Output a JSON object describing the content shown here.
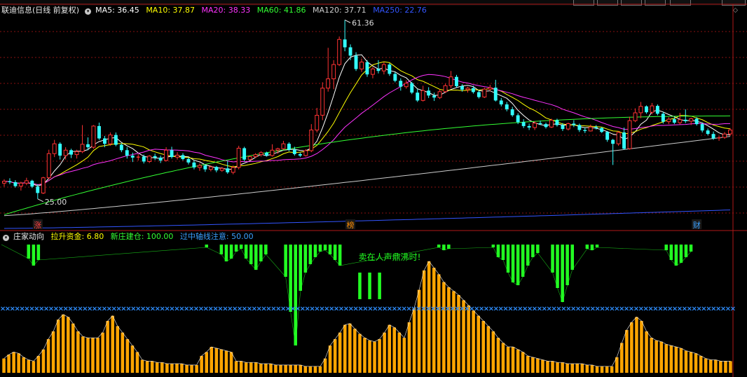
{
  "window": {
    "title": "联迪信息"
  },
  "main_chart": {
    "legend": {
      "title": "联迪信息(日线 前复权)",
      "ma": [
        {
          "label": "MA5: 36.45",
          "color": "#ffffff"
        },
        {
          "label": "MA10: 37.87",
          "color": "#ffff00"
        },
        {
          "label": "MA20: 38.33",
          "color": "#ff33ff"
        },
        {
          "label": "MA60: 41.86",
          "color": "#33ff33"
        },
        {
          "label": "MA120: 37.71",
          "color": "#cccccc"
        },
        {
          "label": "MA250: 22.76",
          "color": "#3355ff"
        }
      ]
    },
    "high_label": "61.36",
    "low_label": "25.00",
    "markers": [
      {
        "text": "涨",
        "color": "#ff4040"
      },
      {
        "text": "榜",
        "color": "#ff8c00"
      },
      {
        "text": "财",
        "color": "#3aa0ff"
      }
    ],
    "colors": {
      "up": "#ff3333",
      "down": "#33ffff",
      "bg": "#000000"
    }
  },
  "indicator": {
    "legend": {
      "name": "庄家动向",
      "items": [
        {
          "label": "拉升资金: 6.80",
          "color": "#ffff00"
        },
        {
          "label": "新庄建仓: 100.00",
          "color": "#33ff33"
        },
        {
          "label": "过中轴线注意: 50.00",
          "color": "#33a0ff"
        }
      ]
    },
    "annotation": "卖在人声鼎沸时!",
    "colors": {
      "bars": "#ffa500",
      "green": "#22ff22",
      "axis": "#2f8fff"
    }
  },
  "chart_data": [
    {
      "type": "candlestick",
      "title": "联迪信息(日线 前复权)",
      "y_range": [
        19,
        62
      ],
      "high": 61.36,
      "low": 25.0,
      "candles": [
        [
          28.2,
          29.0,
          27.5,
          28.6
        ],
        [
          28.6,
          29.2,
          28.0,
          28.4
        ],
        [
          28.4,
          28.8,
          27.3,
          27.6
        ],
        [
          27.6,
          28.5,
          26.7,
          28.2
        ],
        [
          28.2,
          29.3,
          27.8,
          28.7
        ],
        [
          28.7,
          28.9,
          27.2,
          27.5
        ],
        [
          27.5,
          28.0,
          25.0,
          26.2
        ],
        [
          26.2,
          29.5,
          26.0,
          29.3
        ],
        [
          29.3,
          35.0,
          29.0,
          34.2
        ],
        [
          34.2,
          37.0,
          33.5,
          36.2
        ],
        [
          36.2,
          36.5,
          33.0,
          33.8
        ],
        [
          33.8,
          35.5,
          33.0,
          34.9
        ],
        [
          34.9,
          35.2,
          33.3,
          34.0
        ],
        [
          34.0,
          35.0,
          33.2,
          34.6
        ],
        [
          34.6,
          40.0,
          34.3,
          36.1
        ],
        [
          36.1,
          37.5,
          34.9,
          35.5
        ],
        [
          35.5,
          40.0,
          35.2,
          39.8
        ],
        [
          39.8,
          40.5,
          37.0,
          37.3
        ],
        [
          37.3,
          37.8,
          35.5,
          36.2
        ],
        [
          36.2,
          38.5,
          35.8,
          38.0
        ],
        [
          38.0,
          38.5,
          35.7,
          36.0
        ],
        [
          36.0,
          36.3,
          34.5,
          34.9
        ],
        [
          34.9,
          35.5,
          33.2,
          33.8
        ],
        [
          33.8,
          34.4,
          32.5,
          33.4
        ],
        [
          33.4,
          34.1,
          32.8,
          33.6
        ],
        [
          33.6,
          34.0,
          32.2,
          32.6
        ],
        [
          32.6,
          33.9,
          32.3,
          33.7
        ],
        [
          33.7,
          34.2,
          32.9,
          33.4
        ],
        [
          33.4,
          33.8,
          32.3,
          32.8
        ],
        [
          32.8,
          35.5,
          32.6,
          34.9
        ],
        [
          34.9,
          35.6,
          33.2,
          33.5
        ],
        [
          33.5,
          34.5,
          33.0,
          33.9
        ],
        [
          33.9,
          34.3,
          32.8,
          33.1
        ],
        [
          33.1,
          33.4,
          32.0,
          32.4
        ],
        [
          32.4,
          32.9,
          31.0,
          31.4
        ],
        [
          31.4,
          32.2,
          30.7,
          31.8
        ],
        [
          31.8,
          32.0,
          30.5,
          31.0
        ],
        [
          31.0,
          31.8,
          30.6,
          31.5
        ],
        [
          31.5,
          31.7,
          30.4,
          30.8
        ],
        [
          30.8,
          31.5,
          30.5,
          31.2
        ],
        [
          31.2,
          32.7,
          30.1,
          30.4
        ],
        [
          30.4,
          31.8,
          30.0,
          31.4
        ],
        [
          31.4,
          35.8,
          31.0,
          35.3
        ],
        [
          35.3,
          35.6,
          32.6,
          33.0
        ],
        [
          33.0,
          33.8,
          32.8,
          33.6
        ],
        [
          33.6,
          34.3,
          33.3,
          34.0
        ],
        [
          34.0,
          34.7,
          33.6,
          34.4
        ],
        [
          34.4,
          34.6,
          33.6,
          33.8
        ],
        [
          33.8,
          36.1,
          33.6,
          34.9
        ],
        [
          34.9,
          35.4,
          34.2,
          35.2
        ],
        [
          35.2,
          36.8,
          35.0,
          36.2
        ],
        [
          36.2,
          36.5,
          34.7,
          35.0
        ],
        [
          35.0,
          35.6,
          33.8,
          34.1
        ],
        [
          34.1,
          34.4,
          33.5,
          33.8
        ],
        [
          33.8,
          35.1,
          33.6,
          34.8
        ],
        [
          34.8,
          40.2,
          34.5,
          39.0
        ],
        [
          39.0,
          43.5,
          38.5,
          42.0
        ],
        [
          42.0,
          48.7,
          41.0,
          47.5
        ],
        [
          47.5,
          55.7,
          46.8,
          49.4
        ],
        [
          49.4,
          53.2,
          47.3,
          52.3
        ],
        [
          52.3,
          58.0,
          52.0,
          57.4
        ],
        [
          57.4,
          61.36,
          55.0,
          55.8
        ],
        [
          55.8,
          56.4,
          53.2,
          54.1
        ],
        [
          54.1,
          54.8,
          51.0,
          51.4
        ],
        [
          51.4,
          53.5,
          50.8,
          52.8
        ],
        [
          52.8,
          53.2,
          49.8,
          50.3
        ],
        [
          50.3,
          51.8,
          49.5,
          51.4
        ],
        [
          51.4,
          53.2,
          50.5,
          51.0
        ],
        [
          51.0,
          52.8,
          50.3,
          52.3
        ],
        [
          52.3,
          52.6,
          50.0,
          50.4
        ],
        [
          50.4,
          50.8,
          48.7,
          49.0
        ],
        [
          49.0,
          49.5,
          47.0,
          47.8
        ],
        [
          47.8,
          49.1,
          47.4,
          48.5
        ],
        [
          48.5,
          48.8,
          46.3,
          46.6
        ],
        [
          46.6,
          47.3,
          44.7,
          45.0
        ],
        [
          45.0,
          48.0,
          44.8,
          47.0
        ],
        [
          47.0,
          47.7,
          45.5,
          46.0
        ],
        [
          46.0,
          46.6,
          44.9,
          45.6
        ],
        [
          45.6,
          47.3,
          45.3,
          46.8
        ],
        [
          46.8,
          48.4,
          46.5,
          48.0
        ],
        [
          48.0,
          51.0,
          47.5,
          49.8
        ],
        [
          49.8,
          50.2,
          47.6,
          47.9
        ],
        [
          47.9,
          48.3,
          46.8,
          47.2
        ],
        [
          47.2,
          47.8,
          46.6,
          47.5
        ],
        [
          47.5,
          48.0,
          46.4,
          46.7
        ],
        [
          46.7,
          47.1,
          45.4,
          45.7
        ],
        [
          45.7,
          47.6,
          45.5,
          47.3
        ],
        [
          47.3,
          48.2,
          46.9,
          47.6
        ],
        [
          47.6,
          49.2,
          44.8,
          45.0
        ],
        [
          45.0,
          45.5,
          43.8,
          44.2
        ],
        [
          44.2,
          44.7,
          42.8,
          43.2
        ],
        [
          43.2,
          43.7,
          41.7,
          42.0
        ],
        [
          42.0,
          42.4,
          40.2,
          40.6
        ],
        [
          40.6,
          41.2,
          39.4,
          39.8
        ],
        [
          39.8,
          40.3,
          39.0,
          39.5
        ],
        [
          39.5,
          40.8,
          39.0,
          40.4
        ],
        [
          40.4,
          40.9,
          40.0,
          40.2
        ],
        [
          40.2,
          40.5,
          39.3,
          39.6
        ],
        [
          39.6,
          41.3,
          39.4,
          41.0
        ],
        [
          41.0,
          41.3,
          39.7,
          40.0
        ],
        [
          40.0,
          40.4,
          38.8,
          39.2
        ],
        [
          39.2,
          40.5,
          38.9,
          40.3
        ],
        [
          40.3,
          41.0,
          39.6,
          40.0
        ],
        [
          40.0,
          40.3,
          38.6,
          39.0
        ],
        [
          39.0,
          39.5,
          38.4,
          38.8
        ],
        [
          38.8,
          40.1,
          38.7,
          39.6
        ],
        [
          39.6,
          40.0,
          39.1,
          39.4
        ],
        [
          39.4,
          39.6,
          38.4,
          38.6
        ],
        [
          38.6,
          38.8,
          36.6,
          37.0
        ],
        [
          37.0,
          37.2,
          31.9,
          36.2
        ],
        [
          36.2,
          38.8,
          35.8,
          38.5
        ],
        [
          38.5,
          39.5,
          35.0,
          35.2
        ],
        [
          35.2,
          41.7,
          35.0,
          40.9
        ],
        [
          40.9,
          43.4,
          40.6,
          42.5
        ],
        [
          42.5,
          44.7,
          41.4,
          43.8
        ],
        [
          43.8,
          44.0,
          42.3,
          42.6
        ],
        [
          42.6,
          44.5,
          42.2,
          43.9
        ],
        [
          43.9,
          44.2,
          42.0,
          42.3
        ],
        [
          42.3,
          42.7,
          40.3,
          40.7
        ],
        [
          40.7,
          41.6,
          40.2,
          41.2
        ],
        [
          41.2,
          41.6,
          40.2,
          40.5
        ],
        [
          40.5,
          42.5,
          40.1,
          41.1
        ],
        [
          41.1,
          43.2,
          40.4,
          40.8
        ],
        [
          40.8,
          41.5,
          40.0,
          41.3
        ],
        [
          41.3,
          41.6,
          39.9,
          40.2
        ],
        [
          40.2,
          40.5,
          38.5,
          38.9
        ],
        [
          38.9,
          39.3,
          37.9,
          38.2
        ],
        [
          38.2,
          38.7,
          37.0,
          37.3
        ],
        [
          37.3,
          37.8,
          36.8,
          37.5
        ],
        [
          37.5,
          38.6,
          37.2,
          38.2
        ],
        [
          38.2,
          39.4,
          37.8,
          39.0
        ]
      ],
      "ma_lines": [
        {
          "name": "MA5",
          "value": 36.45,
          "color": "#ffffff"
        },
        {
          "name": "MA10",
          "value": 37.87,
          "color": "#ffff00"
        },
        {
          "name": "MA20",
          "value": 38.33,
          "color": "#ff33ff"
        },
        {
          "name": "MA60",
          "value": 41.86,
          "color": "#33ff33"
        },
        {
          "name": "MA120",
          "value": 37.71,
          "color": "#cccccc"
        },
        {
          "name": "MA250",
          "value": 22.76,
          "color": "#3355ff"
        }
      ]
    },
    {
      "type": "bar",
      "title": "庄家动向",
      "y_range": [
        0,
        100
      ],
      "midline": 50,
      "orange_values": [
        11,
        14,
        16,
        15,
        12,
        10,
        9,
        13,
        18,
        26,
        32,
        41,
        45,
        43,
        38,
        32,
        28,
        27,
        27,
        27,
        31,
        40,
        44,
        36,
        31,
        26,
        21,
        16,
        10,
        9,
        9,
        8,
        8,
        7,
        7,
        7,
        7,
        6,
        6,
        6,
        13,
        16,
        20,
        19,
        18,
        17,
        16,
        9,
        9,
        8,
        8,
        8,
        7,
        7,
        7,
        6,
        6,
        6,
        6,
        6,
        6,
        5,
        5,
        5,
        5,
        11,
        21,
        26,
        31,
        37,
        38,
        34,
        30,
        27,
        25,
        24,
        26,
        31,
        37,
        35,
        31,
        27,
        39,
        50,
        64,
        79,
        86,
        81,
        76,
        70,
        66,
        63,
        60,
        56,
        52,
        48,
        44,
        40,
        36,
        32,
        27,
        23,
        20,
        20,
        18,
        16,
        13,
        12,
        11,
        10,
        9,
        9,
        8,
        8,
        7,
        7,
        7,
        7,
        6,
        6,
        5,
        5,
        5,
        5,
        12,
        23,
        33,
        39,
        43,
        40,
        32,
        27,
        25,
        24,
        22,
        21,
        20,
        19,
        17,
        16,
        15,
        13,
        11,
        10,
        10,
        9,
        9,
        9
      ],
      "green_values": [
        0,
        0,
        0,
        0,
        0,
        0,
        0,
        0,
        0,
        0,
        0,
        0,
        0,
        0,
        0,
        0,
        0,
        0,
        0,
        0,
        0,
        0,
        0,
        0,
        0,
        0,
        0,
        0,
        0,
        0,
        0,
        0,
        0,
        0,
        0,
        0,
        0,
        0,
        0,
        0,
        0,
        0,
        12,
        20,
        18,
        8,
        0,
        0,
        0,
        0,
        0,
        0,
        0,
        0,
        0,
        0,
        0,
        0,
        0,
        0,
        0,
        0,
        0,
        0,
        0,
        0,
        0,
        0,
        0,
        0,
        0,
        0,
        0,
        0,
        0,
        0,
        0,
        0,
        0,
        0,
        0,
        0,
        0,
        0,
        0,
        0,
        0,
        0,
        0,
        0,
        0,
        0,
        0,
        0,
        0,
        0,
        0,
        0,
        0,
        0,
        0,
        0,
        0,
        0,
        0,
        0,
        0,
        0,
        0,
        0,
        0,
        0,
        0,
        0,
        0,
        0,
        0,
        0,
        0,
        0,
        0,
        0,
        0,
        0,
        0,
        0,
        0,
        0,
        0,
        0,
        0,
        0,
        0,
        0,
        0,
        0,
        0,
        0,
        0,
        0,
        0,
        0,
        0,
        0,
        0,
        0
      ]
    }
  ]
}
